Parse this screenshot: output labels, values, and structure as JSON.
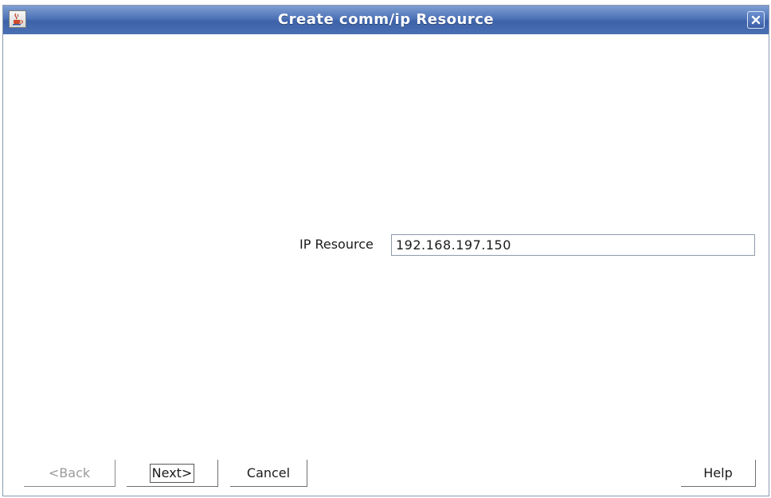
{
  "window": {
    "title": "Create comm/ip Resource",
    "app_icon": "java-cup-icon",
    "close_icon": "close-icon"
  },
  "form": {
    "ip_label": "IP Resource",
    "ip_value": "192.168.197.150"
  },
  "buttons": {
    "back": "<Back",
    "next": "Next>",
    "cancel": "Cancel",
    "help": "Help"
  },
  "colors": {
    "titlebar": "#4e73b8",
    "title_text": "#ffffff",
    "disabled_text": "#9a9a9a"
  }
}
